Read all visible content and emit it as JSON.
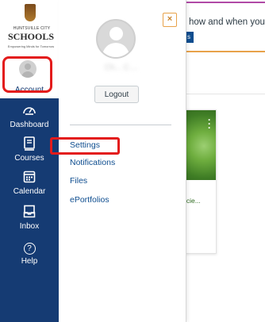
{
  "background": {
    "banner_text": "how and when you w",
    "banner_button": "s",
    "card_text": "rcie..."
  },
  "logo": {
    "top_text": "HUNTSVILLE CITY",
    "main_text": "SCHOOLS",
    "tagline": "Empowering Minds for Tomorrow"
  },
  "nav": {
    "account": {
      "label": "Account",
      "icon": "user-avatar-icon"
    },
    "items": [
      {
        "label": "Dashboard",
        "icon": "speedometer-icon"
      },
      {
        "label": "Courses",
        "icon": "book-icon"
      },
      {
        "label": "Calendar",
        "icon": "calendar-icon"
      },
      {
        "label": "Inbox",
        "icon": "inbox-icon"
      },
      {
        "label": "Help",
        "icon": "question-circle-icon"
      }
    ],
    "colors": {
      "nav_bg": "#153b73",
      "highlight": "#e31b1b"
    }
  },
  "tray": {
    "close_symbol": "×",
    "user_name": "Ch... C....",
    "logout_label": "Logout",
    "links": [
      "Settings",
      "Notifications",
      "Files",
      "ePortfolios"
    ]
  }
}
